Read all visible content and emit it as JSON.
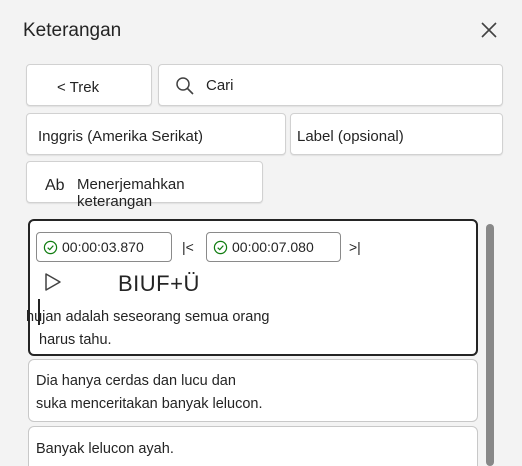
{
  "panel": {
    "title": "Keterangan"
  },
  "toolbar": {
    "back_label": "< Trek",
    "search_value": "Cari"
  },
  "options": {
    "language": "Inggris (Amerika Serikat)",
    "label_placeholder": "Label (opsional)",
    "translate_icon_text": "Ab",
    "translate_label": "Menerjemahkan keterangan"
  },
  "captions": [
    {
      "start": "00:00:03.870",
      "end": "00:00:07.080",
      "format_toolbar": "BIUF+Ü",
      "line1": "hujan adalah seseorang semua orang",
      "line2": "harus tahu."
    },
    {
      "line1": "Dia hanya cerdas dan lucu dan",
      "line2": "suka menceritakan banyak lelucon."
    },
    {
      "line1": "Banyak lelucon ayah."
    }
  ],
  "colors": {
    "background": "#f3f3f3",
    "card": "#ffffff",
    "text": "#242424",
    "active_border": "#242424",
    "check": "#107c10"
  }
}
